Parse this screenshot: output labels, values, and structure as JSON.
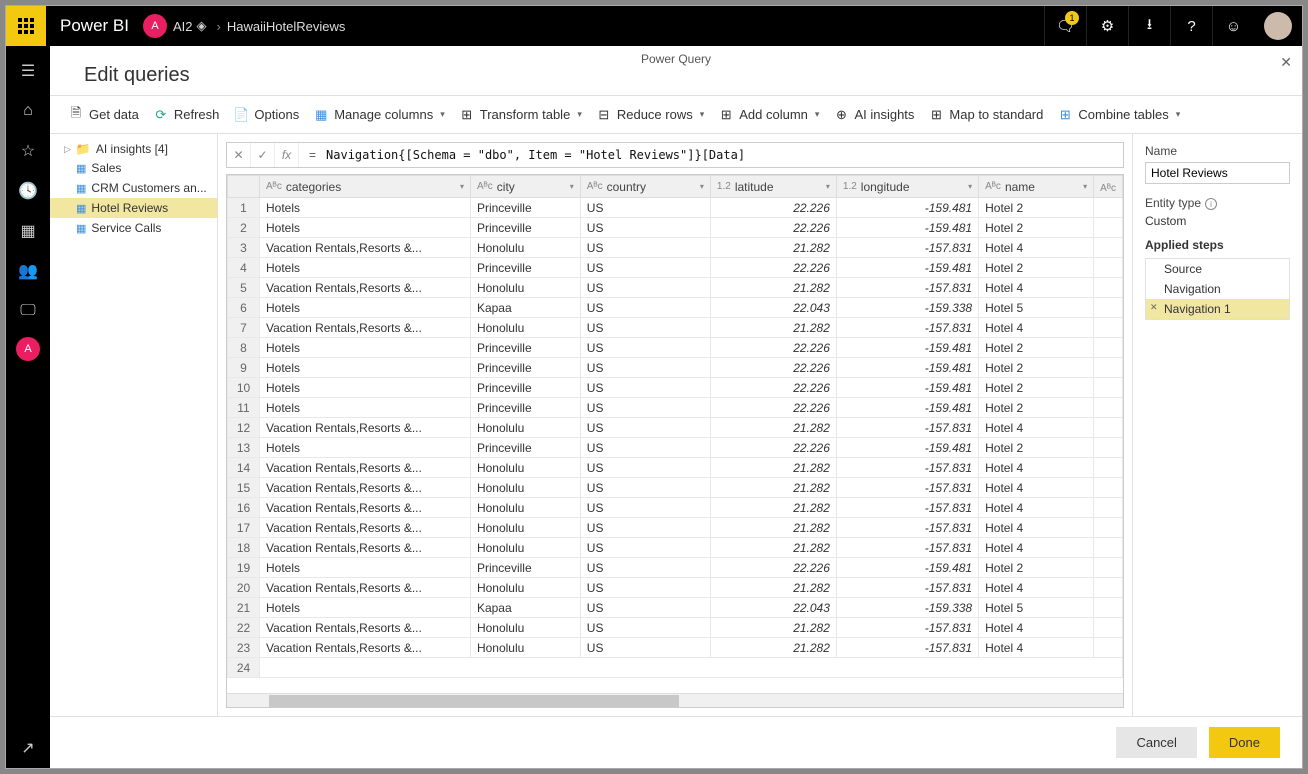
{
  "topbar": {
    "brand": "Power BI",
    "workspace_initial": "A",
    "workspace_name": "AI2",
    "breadcrumb_sep": "›",
    "dataset": "HawaiiHotelReviews",
    "notif_badge": "1"
  },
  "page": {
    "center_title": "Power Query",
    "title": "Edit queries"
  },
  "ribbon": {
    "get_data": "Get data",
    "refresh": "Refresh",
    "options": "Options",
    "manage_columns": "Manage columns",
    "transform_table": "Transform table",
    "reduce_rows": "Reduce rows",
    "add_column": "Add column",
    "ai_insights": "AI insights",
    "map_standard": "Map to standard",
    "combine_tables": "Combine tables"
  },
  "queries": {
    "group": "AI insights  [4]",
    "items": [
      "Sales",
      "CRM Customers an...",
      "Hotel Reviews",
      "Service Calls"
    ],
    "selected_index": 2
  },
  "formula": {
    "eq": "=",
    "expr": "Navigation{[Schema = \"dbo\", Item = \"Hotel Reviews\"]}[Data]"
  },
  "grid": {
    "columns": [
      {
        "type": "Aᴮc",
        "label": "categories"
      },
      {
        "type": "Aᴮc",
        "label": "city"
      },
      {
        "type": "Aᴮc",
        "label": "country"
      },
      {
        "type": "1.2",
        "label": "latitude"
      },
      {
        "type": "1.2",
        "label": "longitude"
      },
      {
        "type": "Aᴮc",
        "label": "name"
      }
    ],
    "rows": [
      {
        "n": 1,
        "categories": "Hotels",
        "city": "Princeville",
        "country": "US",
        "lat": "22.226",
        "lon": "-159.481",
        "name": "Hotel 2"
      },
      {
        "n": 2,
        "categories": "Hotels",
        "city": "Princeville",
        "country": "US",
        "lat": "22.226",
        "lon": "-159.481",
        "name": "Hotel 2"
      },
      {
        "n": 3,
        "categories": "Vacation Rentals,Resorts &...",
        "city": "Honolulu",
        "country": "US",
        "lat": "21.282",
        "lon": "-157.831",
        "name": "Hotel 4"
      },
      {
        "n": 4,
        "categories": "Hotels",
        "city": "Princeville",
        "country": "US",
        "lat": "22.226",
        "lon": "-159.481",
        "name": "Hotel 2"
      },
      {
        "n": 5,
        "categories": "Vacation Rentals,Resorts &...",
        "city": "Honolulu",
        "country": "US",
        "lat": "21.282",
        "lon": "-157.831",
        "name": "Hotel 4"
      },
      {
        "n": 6,
        "categories": "Hotels",
        "city": "Kapaa",
        "country": "US",
        "lat": "22.043",
        "lon": "-159.338",
        "name": "Hotel 5"
      },
      {
        "n": 7,
        "categories": "Vacation Rentals,Resorts &...",
        "city": "Honolulu",
        "country": "US",
        "lat": "21.282",
        "lon": "-157.831",
        "name": "Hotel 4"
      },
      {
        "n": 8,
        "categories": "Hotels",
        "city": "Princeville",
        "country": "US",
        "lat": "22.226",
        "lon": "-159.481",
        "name": "Hotel 2"
      },
      {
        "n": 9,
        "categories": "Hotels",
        "city": "Princeville",
        "country": "US",
        "lat": "22.226",
        "lon": "-159.481",
        "name": "Hotel 2"
      },
      {
        "n": 10,
        "categories": "Hotels",
        "city": "Princeville",
        "country": "US",
        "lat": "22.226",
        "lon": "-159.481",
        "name": "Hotel 2"
      },
      {
        "n": 11,
        "categories": "Hotels",
        "city": "Princeville",
        "country": "US",
        "lat": "22.226",
        "lon": "-159.481",
        "name": "Hotel 2"
      },
      {
        "n": 12,
        "categories": "Vacation Rentals,Resorts &...",
        "city": "Honolulu",
        "country": "US",
        "lat": "21.282",
        "lon": "-157.831",
        "name": "Hotel 4"
      },
      {
        "n": 13,
        "categories": "Hotels",
        "city": "Princeville",
        "country": "US",
        "lat": "22.226",
        "lon": "-159.481",
        "name": "Hotel 2"
      },
      {
        "n": 14,
        "categories": "Vacation Rentals,Resorts &...",
        "city": "Honolulu",
        "country": "US",
        "lat": "21.282",
        "lon": "-157.831",
        "name": "Hotel 4"
      },
      {
        "n": 15,
        "categories": "Vacation Rentals,Resorts &...",
        "city": "Honolulu",
        "country": "US",
        "lat": "21.282",
        "lon": "-157.831",
        "name": "Hotel 4"
      },
      {
        "n": 16,
        "categories": "Vacation Rentals,Resorts &...",
        "city": "Honolulu",
        "country": "US",
        "lat": "21.282",
        "lon": "-157.831",
        "name": "Hotel 4"
      },
      {
        "n": 17,
        "categories": "Vacation Rentals,Resorts &...",
        "city": "Honolulu",
        "country": "US",
        "lat": "21.282",
        "lon": "-157.831",
        "name": "Hotel 4"
      },
      {
        "n": 18,
        "categories": "Vacation Rentals,Resorts &...",
        "city": "Honolulu",
        "country": "US",
        "lat": "21.282",
        "lon": "-157.831",
        "name": "Hotel 4"
      },
      {
        "n": 19,
        "categories": "Hotels",
        "city": "Princeville",
        "country": "US",
        "lat": "22.226",
        "lon": "-159.481",
        "name": "Hotel 2"
      },
      {
        "n": 20,
        "categories": "Vacation Rentals,Resorts &...",
        "city": "Honolulu",
        "country": "US",
        "lat": "21.282",
        "lon": "-157.831",
        "name": "Hotel 4"
      },
      {
        "n": 21,
        "categories": "Hotels",
        "city": "Kapaa",
        "country": "US",
        "lat": "22.043",
        "lon": "-159.338",
        "name": "Hotel 5"
      },
      {
        "n": 22,
        "categories": "Vacation Rentals,Resorts &...",
        "city": "Honolulu",
        "country": "US",
        "lat": "21.282",
        "lon": "-157.831",
        "name": "Hotel 4"
      },
      {
        "n": 23,
        "categories": "Vacation Rentals,Resorts &...",
        "city": "Honolulu",
        "country": "US",
        "lat": "21.282",
        "lon": "-157.831",
        "name": "Hotel 4"
      }
    ],
    "next_row": "24"
  },
  "rightpane": {
    "name_label": "Name",
    "name_value": "Hotel Reviews",
    "entity_label": "Entity type",
    "entity_value": "Custom",
    "steps_label": "Applied steps",
    "steps": [
      "Source",
      "Navigation",
      "Navigation 1"
    ],
    "selected_step": 2
  },
  "footer": {
    "cancel": "Cancel",
    "done": "Done"
  }
}
